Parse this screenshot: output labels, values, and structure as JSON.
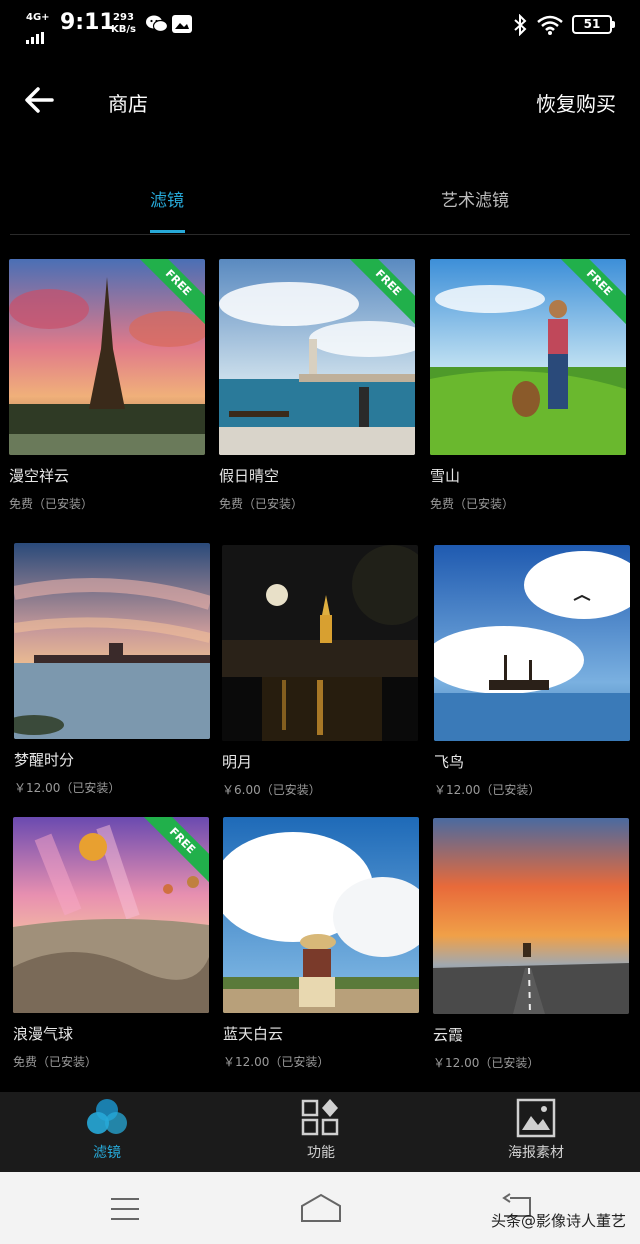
{
  "status_bar": {
    "network": "4G+",
    "time": "9:11",
    "speed_value": "293",
    "speed_unit": "KB/s",
    "battery": "51"
  },
  "header": {
    "title": "商店",
    "restore_label": "恢复购买"
  },
  "tabs": [
    {
      "label": "滤镜",
      "active": true
    },
    {
      "label": "艺术滤镜",
      "active": false
    }
  ],
  "cards": [
    {
      "name": "漫空祥云",
      "price": "免费（已安装）",
      "free_badge": "FREE"
    },
    {
      "name": "假日晴空",
      "price": "免费（已安装）",
      "free_badge": "FREE"
    },
    {
      "name": "雪山",
      "price": "免费（已安装）",
      "free_badge": "FREE"
    },
    {
      "name": "梦醒时分",
      "price": "￥12.00（已安装）",
      "free_badge": ""
    },
    {
      "name": "明月",
      "price": "￥6.00（已安装）",
      "free_badge": ""
    },
    {
      "name": "飞鸟",
      "price": "￥12.00（已安装）",
      "free_badge": ""
    },
    {
      "name": "浪漫气球",
      "price": "免费（已安装）",
      "free_badge": "FREE"
    },
    {
      "name": "蓝天白云",
      "price": "￥12.00（已安装）",
      "free_badge": ""
    },
    {
      "name": "云霞",
      "price": "￥12.00（已安装）",
      "free_badge": ""
    }
  ],
  "bottom_nav": [
    {
      "label": "滤镜",
      "icon": "filter-circles-icon",
      "active": true
    },
    {
      "label": "功能",
      "icon": "function-grid-icon",
      "active": false
    },
    {
      "label": "海报素材",
      "icon": "poster-image-icon",
      "active": false
    }
  ],
  "watermark": "头条@影像诗人董艺",
  "colors": {
    "accent": "#27a9d8",
    "free_ribbon": "#21b04b"
  }
}
